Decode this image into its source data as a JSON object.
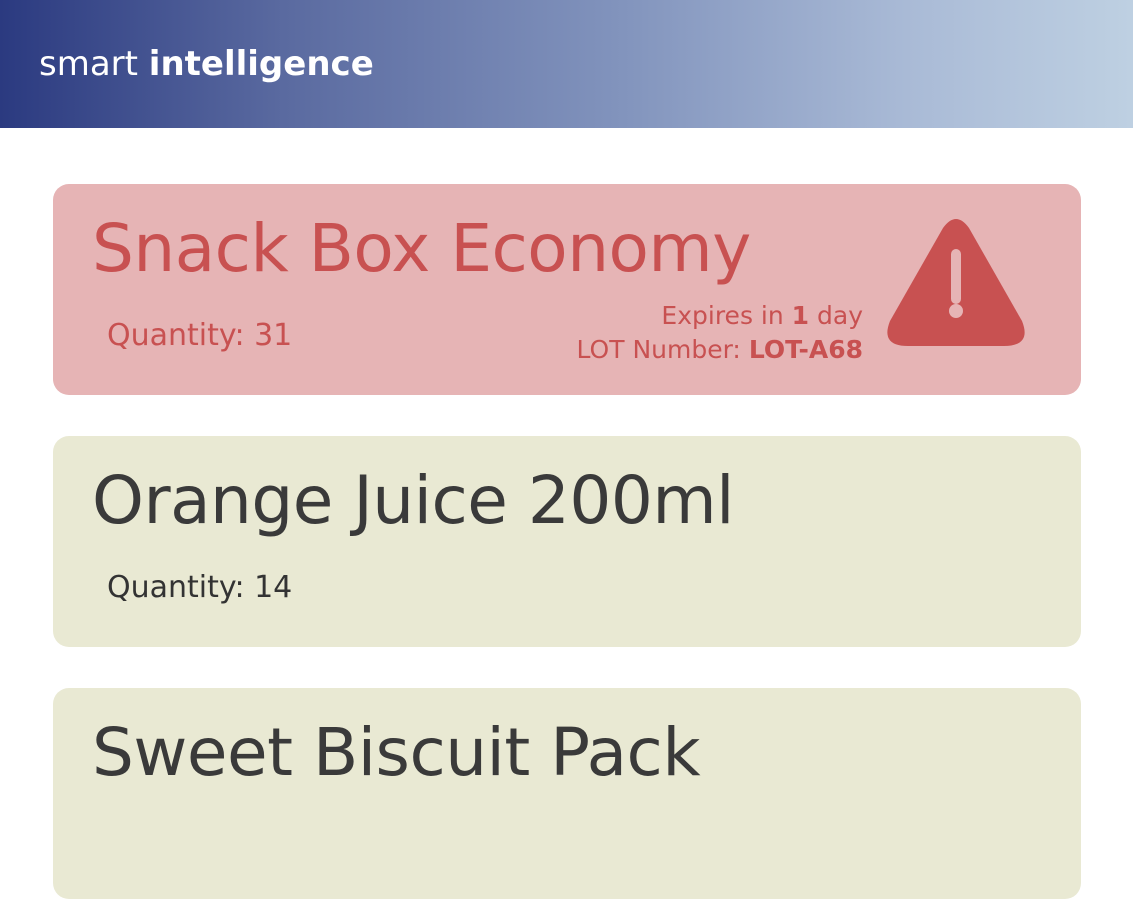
{
  "header": {
    "brand_light": "smart",
    "brand_bold": "intelligence"
  },
  "items": [
    {
      "name": "Snack Box Economy",
      "quantity_text": "Quantity: 31",
      "status": "alert",
      "expires_prefix": "Expires in",
      "expires_value": "1",
      "expires_suffix": "day",
      "lot_label": "LOT Number:",
      "lot_value": "LOT-A68",
      "icon": "warning-icon"
    },
    {
      "name": "Orange Juice 200ml",
      "quantity_text": "Quantity: 14",
      "status": "normal"
    },
    {
      "name": "Sweet Biscuit Pack",
      "status": "normal"
    }
  ],
  "colors": {
    "alert_bg": "#e6b4b5",
    "alert_text": "#c85151",
    "normal_bg": "#e9e9d3",
    "normal_text": "#3a3a3a",
    "header_start": "#2b3a80",
    "header_end": "#bed0e2"
  }
}
